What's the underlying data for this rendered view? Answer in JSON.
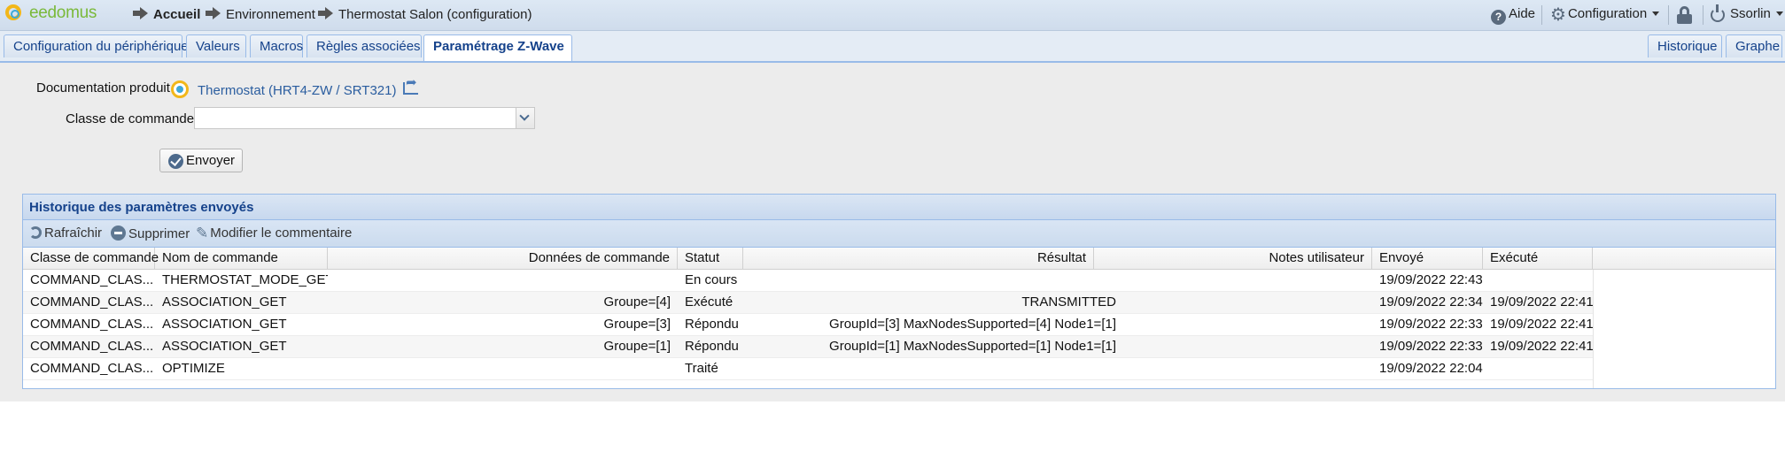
{
  "app": {
    "logo_text": "eedomus"
  },
  "breadcrumb": {
    "home": "Accueil",
    "environment": "Environnement",
    "current": "Thermostat Salon (configuration)"
  },
  "top_menu": {
    "help": "Aide",
    "configuration": "Configuration",
    "user": "Ssorlin"
  },
  "tabs": [
    {
      "label": "Configuration du périphérique",
      "active": false
    },
    {
      "label": "Valeurs",
      "active": false
    },
    {
      "label": "Macros",
      "active": false
    },
    {
      "label": "Règles associées",
      "active": false
    },
    {
      "label": "Paramétrage Z-Wave",
      "active": true
    }
  ],
  "right_tabs": [
    {
      "label": "Historique"
    },
    {
      "label": "Graphe"
    }
  ],
  "form": {
    "doc_label": "Documentation produit",
    "doc_link": "Thermostat (HRT4-ZW / SRT321)",
    "command_class_label": "Classe de commande",
    "command_class_value": "",
    "send_button": "Envoyer"
  },
  "history": {
    "title": "Historique des paramètres envoyés",
    "toolbar": {
      "refresh": "Rafraîchir",
      "delete": "Supprimer",
      "edit_comment": "Modifier le commentaire"
    },
    "columns": [
      "Classe de commande",
      "Nom de commande",
      "Données de commande",
      "Statut",
      "Résultat",
      "Notes utilisateur",
      "Envoyé",
      "Exécuté"
    ],
    "rows": [
      {
        "classe": "COMMAND_CLAS...",
        "nom": "THERMOSTAT_MODE_GET",
        "donnees": "",
        "statut": "En cours",
        "resultat": "",
        "notes": "",
        "envoye": "19/09/2022 22:43",
        "execute": ""
      },
      {
        "classe": "COMMAND_CLAS...",
        "nom": "ASSOCIATION_GET",
        "donnees": "Groupe=[4]",
        "statut": "Exécuté",
        "resultat": "TRANSMITTED",
        "notes": "",
        "envoye": "19/09/2022 22:34",
        "execute": "19/09/2022 22:41"
      },
      {
        "classe": "COMMAND_CLAS...",
        "nom": "ASSOCIATION_GET",
        "donnees": "Groupe=[3]",
        "statut": "Répondu",
        "resultat": "GroupId=[3] MaxNodesSupported=[4] Node1=[1]",
        "notes": "",
        "envoye": "19/09/2022 22:33",
        "execute": "19/09/2022 22:41"
      },
      {
        "classe": "COMMAND_CLAS...",
        "nom": "ASSOCIATION_GET",
        "donnees": "Groupe=[1]",
        "statut": "Répondu",
        "resultat": "GroupId=[1] MaxNodesSupported=[1] Node1=[1]",
        "notes": "",
        "envoye": "19/09/2022 22:33",
        "execute": "19/09/2022 22:41"
      },
      {
        "classe": "COMMAND_CLAS...",
        "nom": "OPTIMIZE",
        "donnees": "",
        "statut": "Traité",
        "resultat": "",
        "notes": "",
        "envoye": "19/09/2022 22:04",
        "execute": ""
      }
    ]
  },
  "colors": {
    "accent": "#15428b",
    "link": "#2a5d9f",
    "logo_green": "#7ab93a",
    "logo_ring": "#f2b71a"
  }
}
